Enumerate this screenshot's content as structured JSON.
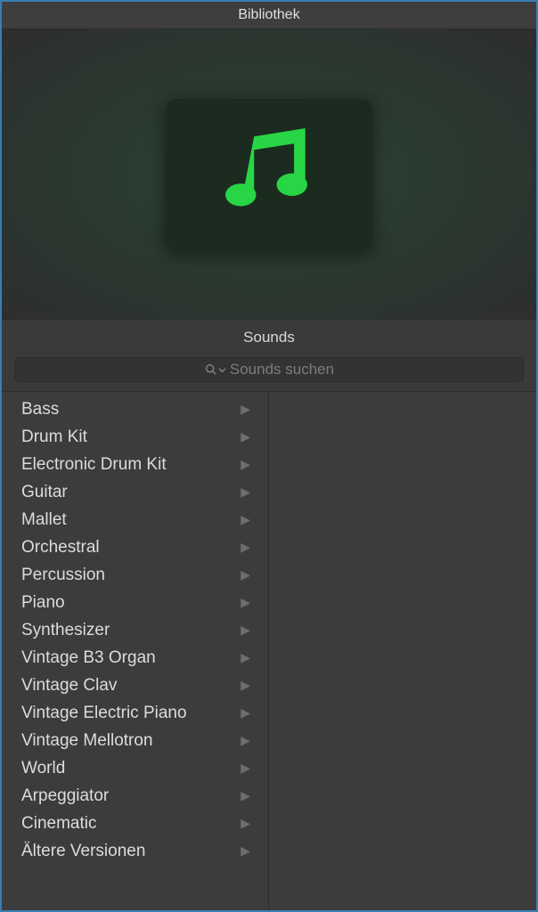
{
  "window": {
    "title": "Bibliothek"
  },
  "section": {
    "label": "Sounds"
  },
  "search": {
    "placeholder": "Sounds suchen"
  },
  "categories": [
    {
      "label": "Bass"
    },
    {
      "label": "Drum Kit"
    },
    {
      "label": "Electronic Drum Kit"
    },
    {
      "label": "Guitar"
    },
    {
      "label": "Mallet"
    },
    {
      "label": "Orchestral"
    },
    {
      "label": "Percussion"
    },
    {
      "label": "Piano"
    },
    {
      "label": "Synthesizer"
    },
    {
      "label": "Vintage B3 Organ"
    },
    {
      "label": "Vintage Clav"
    },
    {
      "label": "Vintage Electric Piano"
    },
    {
      "label": "Vintage Mellotron"
    },
    {
      "label": "World"
    },
    {
      "label": "Arpeggiator"
    },
    {
      "label": "Cinematic"
    },
    {
      "label": "Ältere Versionen"
    }
  ]
}
